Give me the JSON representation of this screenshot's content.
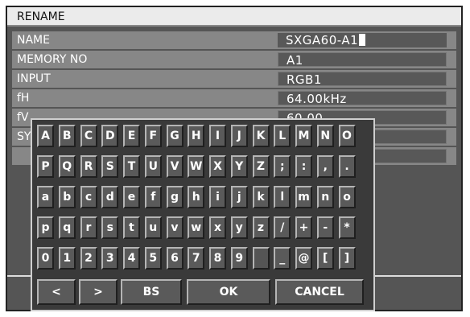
{
  "window": {
    "title": "RENAME"
  },
  "fields": [
    {
      "label": "NAME",
      "value": "SXGA60-A1"
    },
    {
      "label": "MEMORY NO",
      "value": "A1"
    },
    {
      "label": "INPUT",
      "value": "RGB1"
    },
    {
      "label": "fH",
      "value": "64.00kHz"
    },
    {
      "label": "fV",
      "value": "60.00"
    },
    {
      "label": "SY",
      "value": ""
    },
    {
      "label": "",
      "value": ""
    }
  ],
  "keyboard": {
    "rows": [
      [
        "A",
        "B",
        "C",
        "D",
        "E",
        "F",
        "G",
        "H",
        "I",
        "J",
        "K",
        "L",
        "M",
        "N",
        "O"
      ],
      [
        "P",
        "Q",
        "R",
        "S",
        "T",
        "U",
        "V",
        "W",
        "X",
        "Y",
        "Z",
        ";",
        ":",
        ",",
        "."
      ],
      [
        "a",
        "b",
        "c",
        "d",
        "e",
        "f",
        "g",
        "h",
        "i",
        "j",
        "k",
        "l",
        "m",
        "n",
        "o"
      ],
      [
        "p",
        "q",
        "r",
        "s",
        "t",
        "u",
        "v",
        "w",
        "x",
        "y",
        "z",
        "/",
        "+",
        "-",
        "*"
      ],
      [
        "0",
        "1",
        "2",
        "3",
        "4",
        "5",
        "6",
        "7",
        "8",
        "9",
        "",
        "_",
        "@",
        "[",
        "]"
      ]
    ],
    "function_keys": {
      "left": "<",
      "right": ">",
      "backspace": "BS",
      "ok": "OK",
      "cancel": "CANCEL"
    }
  }
}
